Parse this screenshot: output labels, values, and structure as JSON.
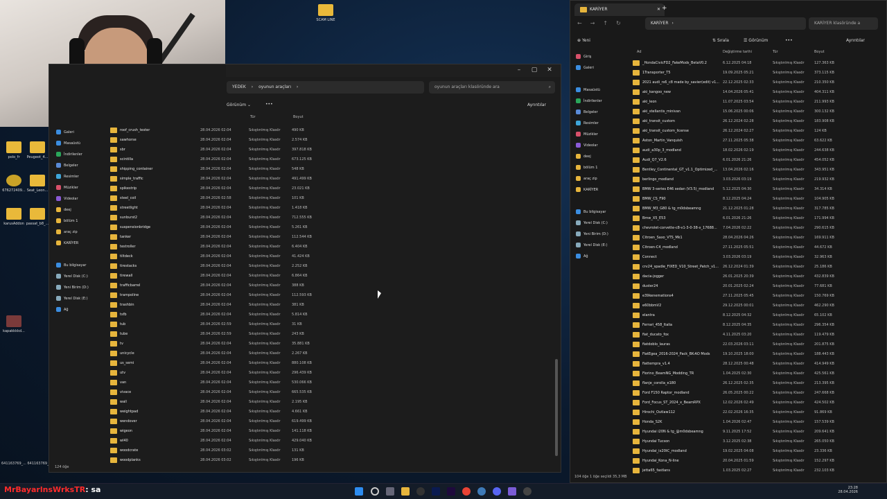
{
  "desktop": {
    "top_icon_label": "SCAM LINE",
    "icons": [
      {
        "label": "polo_fr"
      },
      {
        "label": "Peugeot_4..."
      },
      {
        "label": "676272409..."
      },
      {
        "label": "Seat_Leon..."
      },
      {
        "label": "karusAddon"
      },
      {
        "label": "passat_b8_..."
      },
      {
        "label": "kapakkkkd..."
      }
    ],
    "corner_text": "641163769_...  641163769_..."
  },
  "left_window": {
    "breadcrumb": [
      "YEDEK",
      "oyunun araçları"
    ],
    "search_placeholder": "oyunun araçları klasöründe ara",
    "view_label": "Görünüm",
    "more_label": "•••",
    "details_label": "Ayrıntılar",
    "columns": {
      "name": "Ad",
      "modified": "Değiştirme tarihi",
      "type": "Tür",
      "size": "Boyut"
    },
    "nav": [
      {
        "label": "Galeri",
        "color": "#3b8de0"
      },
      {
        "label": "Masaüstü",
        "color": "#3b8de0"
      },
      {
        "label": "İndirilenler",
        "color": "#2aa65a"
      },
      {
        "label": "Belgeler",
        "color": "#5a8ad6"
      },
      {
        "label": "Resimler",
        "color": "#3ea5d8"
      },
      {
        "label": "Müzikler",
        "color": "#d8506a"
      },
      {
        "label": "Videolar",
        "color": "#8a5ad6"
      },
      {
        "label": "deej",
        "color": "#e7b53c"
      },
      {
        "label": "bölüm 1",
        "color": "#e7b53c"
      },
      {
        "label": "araç zip",
        "color": "#e7b53c"
      },
      {
        "label": "KARİYER",
        "color": "#e7b53c"
      },
      {
        "label": "",
        "color": ""
      },
      {
        "label": "Bu bilgisayar",
        "color": "#3b8de0"
      },
      {
        "label": "Yerel Disk (C:)",
        "color": "#8ab"
      },
      {
        "label": "Yeni Birim (D:)",
        "color": "#8ab"
      },
      {
        "label": "Yerel Disk (E:)",
        "color": "#8ab"
      },
      {
        "label": "Ağ",
        "color": "#3b8de0"
      }
    ],
    "files": [
      [
        "roof_crush_tester",
        "28.04.2026 02:04",
        "Sıkıştırılmış Klasör",
        "490 KB"
      ],
      [
        "sawhorse",
        "28.04.2026 02:04",
        "Sıkıştırılmış Klasör",
        "2.574 KB"
      ],
      [
        "sbr",
        "28.04.2026 02:04",
        "Sıkıştırılmış Klasör",
        "397.818 KB"
      ],
      [
        "scintilla",
        "28.04.2026 02:04",
        "Sıkıştırılmış Klasör",
        "673.125 KB"
      ],
      [
        "shipping_container",
        "28.04.2026 02:04",
        "Sıkıştırılmış Klasör",
        "548 KB"
      ],
      [
        "simple_traffic",
        "28.04.2026 02:04",
        "Sıkıştırılmış Klasör",
        "491.499 KB"
      ],
      [
        "spikestrip",
        "28.04.2026 02:04",
        "Sıkıştırılmış Klasör",
        "23.021 KB"
      ],
      [
        "steel_coil",
        "28.04.2026 02:58",
        "Sıkıştırılmış Klasör",
        "101 KB"
      ],
      [
        "streetlight",
        "28.04.2026 02:04",
        "Sıkıştırılmış Klasör",
        "1.418 KB"
      ],
      [
        "sunburst2",
        "28.04.2026 02:04",
        "Sıkıştırılmış Klasör",
        "712.555 KB"
      ],
      [
        "suspensionbridge",
        "28.04.2026 02:04",
        "Sıkıştırılmış Klasör",
        "5.261 KB"
      ],
      [
        "tanker",
        "28.04.2026 02:04",
        "Sıkıştırılmış Klasör",
        "112.544 KB"
      ],
      [
        "testroller",
        "28.04.2026 02:04",
        "Sıkıştırılmış Klasör",
        "6.404 KB"
      ],
      [
        "tiltdeck",
        "28.04.2026 02:04",
        "Sıkıştırılmış Klasör",
        "41.424 KB"
      ],
      [
        "tirestacks",
        "28.04.2026 02:04",
        "Sıkıştırılmış Klasör",
        "2.252 KB"
      ],
      [
        "tirewall",
        "28.04.2026 02:04",
        "Sıkıştırılmış Klasör",
        "6.864 KB"
      ],
      [
        "trafficbarrel",
        "28.04.2026 02:04",
        "Sıkıştırılmış Klasör",
        "388 KB"
      ],
      [
        "trampoline",
        "28.04.2026 02:04",
        "Sıkıştırılmış Klasör",
        "112.593 KB"
      ],
      [
        "trashbin",
        "28.04.2026 02:04",
        "Sıkıştırılmış Klasör",
        "381 KB"
      ],
      [
        "tsfb",
        "28.04.2026 02:04",
        "Sıkıştırılmış Klasör",
        "5.814 KB"
      ],
      [
        "tub",
        "28.04.2026 02:59",
        "Sıkıştırılmış Klasör",
        "31 KB"
      ],
      [
        "tube",
        "28.04.2026 02:59",
        "Sıkıştırılmış Klasör",
        "243 KB"
      ],
      [
        "tv",
        "28.04.2026 02:04",
        "Sıkıştırılmış Klasör",
        "35.881 KB"
      ],
      [
        "unicycle",
        "28.04.2026 02:04",
        "Sıkıştırılmış Klasör",
        "2.267 KB"
      ],
      [
        "us_semi",
        "28.04.2026 02:04",
        "Sıkıştırılmış Klasör",
        "880.108 KB"
      ],
      [
        "utv",
        "28.04.2026 02:04",
        "Sıkıştırılmış Klasör",
        "296.439 KB"
      ],
      [
        "van",
        "28.04.2026 02:04",
        "Sıkıştırılmış Klasör",
        "530.066 KB"
      ],
      [
        "vivace",
        "28.04.2026 02:04",
        "Sıkıştırılmış Klasör",
        "665.535 KB"
      ],
      [
        "wall",
        "28.04.2026 02:04",
        "Sıkıştırılmış Klasör",
        "2.195 KB"
      ],
      [
        "weightpad",
        "28.04.2026 02:04",
        "Sıkıştırılmış Klasör",
        "4.661 KB"
      ],
      [
        "wendover",
        "28.04.2026 02:04",
        "Sıkıştırılmış Klasör",
        "619.499 KB"
      ],
      [
        "wigeon",
        "28.04.2026 02:04",
        "Sıkıştırılmış Klasör",
        "141.118 KB"
      ],
      [
        "wl40",
        "28.04.2026 02:04",
        "Sıkıştırılmış Klasör",
        "429.040 KB"
      ],
      [
        "woodcrate",
        "28.04.2026 03:02",
        "Sıkıştırılmış Klasör",
        "131 KB"
      ],
      [
        "woodplanks",
        "28.04.2026 03:02",
        "Sıkıştırılmış Klasör",
        "196 KB"
      ]
    ],
    "status": "124 öğe"
  },
  "right_window": {
    "tab_title": "KARİYER",
    "new_tab": "+",
    "breadcrumb": "KARİYER",
    "search_placeholder": "KARİYER klasöründe a",
    "toolbar": {
      "new": "Yeni",
      "sort": "Sırala",
      "view": "Görünüm",
      "more": "•••",
      "details": "Ayrıntılar"
    },
    "columns": {
      "name": "Ad",
      "modified": "Değiştirme tarihi",
      "type": "Tür",
      "size": "Boyut"
    },
    "nav": [
      {
        "label": "Giriş",
        "color": "#d8506a"
      },
      {
        "label": "Galeri",
        "color": "#3b8de0"
      },
      {
        "label": "",
        "color": ""
      },
      {
        "label": "Masaüstü",
        "color": "#3b8de0"
      },
      {
        "label": "İndirilenler",
        "color": "#2aa65a"
      },
      {
        "label": "Belgeler",
        "color": "#5a8ad6"
      },
      {
        "label": "Resimler",
        "color": "#3ea5d8"
      },
      {
        "label": "Müzikler",
        "color": "#d8506a"
      },
      {
        "label": "Videolar",
        "color": "#8a5ad6"
      },
      {
        "label": "deej",
        "color": "#e7b53c"
      },
      {
        "label": "bölüm 1",
        "color": "#e7b53c"
      },
      {
        "label": "araç zip",
        "color": "#e7b53c"
      },
      {
        "label": "KARİYER",
        "color": "#e7b53c"
      },
      {
        "label": "",
        "color": ""
      },
      {
        "label": "Bu bilgisayar",
        "color": "#3b8de0"
      },
      {
        "label": "Yerel Disk (C:)",
        "color": "#8ab"
      },
      {
        "label": "Yeni Birim (D:)",
        "color": "#8ab"
      },
      {
        "label": "Yerel Disk (E:)",
        "color": "#8ab"
      },
      {
        "label": "Ağ",
        "color": "#3b8de0"
      }
    ],
    "files": [
      [
        "_HondaCivicFD2_FakeMods_BetaV0.2",
        "6.12.2025 04:18",
        "Sıkıştırılmış Klasör",
        "127.363 KB"
      ],
      [
        "1Transporter_T5",
        "19.09.2025 05:21",
        "Sıkıştırılmış Klasör",
        "373.115 KB"
      ],
      [
        "2021 audi_rs6_c8 made by_savier(edit) v1...",
        "22.12.2025 02:33",
        "Sıkıştırılmış Klasör",
        "210.350 KB"
      ],
      [
        "aki_kangoo_new",
        "14.04.2026 05:41",
        "Sıkıştırılmış Klasör",
        "404.311 KB"
      ],
      [
        "aki_leon",
        "11.07.2025 03:54",
        "Sıkıştırılmış Klasör",
        "211.993 KB"
      ],
      [
        "aki_stellantis_minivan",
        "15.06.2025 00:06",
        "Sıkıştırılmış Klasör",
        "300.132 KB"
      ],
      [
        "aki_transit_custom",
        "26.12.2024 02:28",
        "Sıkıştırılmış Klasör",
        "183.908 KB"
      ],
      [
        "aki_transit_custom_license",
        "26.12.2024 02:27",
        "Sıkıştırılmış Klasör",
        "124 KB"
      ],
      [
        "Aston_Martin_Vanquish",
        "27.11.2025 05:38",
        "Sıkıştırılmış Klasör",
        "63.622 KB"
      ],
      [
        "audi_a30p_3_modland",
        "18.02.2026 02:19",
        "Sıkıştırılmış Klasör",
        "244.638 KB"
      ],
      [
        "Audi_Q7_V2.6",
        "6.01.2026 21:26",
        "Sıkıştırılmış Klasör",
        "454.052 KB"
      ],
      [
        "Bentley_Continental_GT_v1.1_Optimized_...",
        "13.04.2026 02:16",
        "Sıkıştırılmış Klasör",
        "343.951 KB"
      ],
      [
        "berlingo_modland",
        "3.03.2026 03:19",
        "Sıkıştırılmış Klasör",
        "219.932 KB"
      ],
      [
        "BMW 3-series E46 sedan (V3.5)_modland",
        "5.12.2025 04:30",
        "Sıkıştırılmış Klasör",
        "34.314 KB"
      ],
      [
        "BMW_CS_F90",
        "8.12.2025 04:24",
        "Sıkıştırılmış Klasör",
        "104.905 KB"
      ],
      [
        "BMW_M3_G80 & tg_m0dsbeamng",
        "21.12.2025 01:28",
        "Sıkıştırılmış Klasör",
        "317.785 KB"
      ],
      [
        "Bmw_X5_E53",
        "6.01.2026 21:26",
        "Sıkıştırılmış Klasör",
        "171.994 KB"
      ],
      [
        "chevrolet-corvette-c8-v1-3-0-38-x_17688...",
        "7.04.2026 02:22",
        "Sıkıştırılmış Klasör",
        "290.615 KB"
      ],
      [
        "Citroen_Saxo_VTS_Mk1",
        "28.04.2026 04:26",
        "Sıkıştırılmış Klasör",
        "169.911 KB"
      ],
      [
        "Citroen-C4_modland",
        "27.11.2025 05:51",
        "Sıkıştırılmış Klasör",
        "44.672 KB"
      ],
      [
        "Connect",
        "3.03.2026 03:19",
        "Sıkıştırılmış Klasör",
        "32.963 KB"
      ],
      [
        "crv24_spadie_FIXED_V10_Street_Patch_v1...",
        "26.12.2024 01:39",
        "Sıkıştırılmış Klasör",
        "25.186 KB"
      ],
      [
        "dacia-jogger",
        "26.01.2025 20:39",
        "Sıkıştırılmış Klasör",
        "432.839 KB"
      ],
      [
        "duster24",
        "20.01.2025 02:24",
        "Sıkıştırılmış Klasör",
        "77.681 KB"
      ],
      [
        "e39kenemations4",
        "27.11.2025 05:45",
        "Sıkıştırılmış Klasör",
        "150.769 KB"
      ],
      [
        "e60bbmV2",
        "29.12.2025 00:01",
        "Sıkıştırılmış Klasör",
        "462.290 KB"
      ],
      [
        "elantra",
        "8.12.2025 04:32",
        "Sıkıştırılmış Klasör",
        "65.102 KB"
      ],
      [
        "Ferrari_458_Italia",
        "8.12.2025 04:35",
        "Sıkıştırılmış Klasör",
        "296.354 KB"
      ],
      [
        "fiat_ducato_fox",
        "4.11.2025 03:20",
        "Sıkıştırılmış Klasör",
        "119.479 KB"
      ],
      [
        "fiatdoblo_lauras",
        "22.03.2026 03:11",
        "Sıkıştırılmış Klasör",
        "201.875 KB"
      ],
      [
        "FiatEgea_2016-2024_Pack_BK-AO Mods",
        "19.10.2025 18:00",
        "Sıkıştırılmış Klasör",
        "188.443 KB"
      ],
      [
        "fiattempra_v1.4",
        "28.12.2025 00:48",
        "Sıkıştırılmış Klasör",
        "414.949 KB"
      ],
      [
        "Fiorino_BeamNG_Modding_TR",
        "1.04.2025 02:30",
        "Sıkıştırılmış Klasör",
        "425.561 KB"
      ],
      [
        "flanje_corolla_e180",
        "26.12.2025 02:35",
        "Sıkıştırılmış Klasör",
        "213.395 KB"
      ],
      [
        "Ford F150 Raptor_modland",
        "26.05.2025 00:22",
        "Sıkıştırılmış Klasör",
        "247.668 KB"
      ],
      [
        "Ford_Focus_ST_2024_x_BeamRPX",
        "12.02.2026 02:49",
        "Sıkıştırılmış Klasör",
        "424.502 KB"
      ],
      [
        "Hirochi_Outlaw112",
        "22.02.2026 16:35",
        "Sıkıştırılmış Klasör",
        "91.869 KB"
      ],
      [
        "Honda_S2K",
        "1.04.2026 02:47",
        "Sıkıştırılmış Klasör",
        "157.539 KB"
      ],
      [
        "Hyundai i20N & tg_@m0dsbeamng",
        "9.11.2025 17:52",
        "Sıkıştırılmış Klasör",
        "209.641 KB"
      ],
      [
        "Hyundai Tucson",
        "3.12.2025 02:38",
        "Sıkıştırılmış Klasör",
        "265.050 KB"
      ],
      [
        "Hyundai_ix20tC_modland",
        "19.02.2025 04:08",
        "Sıkıştırılmış Klasör",
        "23.336 KB"
      ],
      [
        "Hyundai_Kona_N-line",
        "20.04.2025 01:59",
        "Sıkıştırılmış Klasör",
        "152.297 KB"
      ],
      [
        "jetta65_fastlans",
        "1.03.2025 02:27",
        "Sıkıştırılmış Klasör",
        "232.103 KB"
      ]
    ],
    "status": "104 öğe   1 öğe seçildi 35,3 MB"
  },
  "chat": {
    "user": "MrBayarlnsWrksTR",
    "message": ": sa"
  },
  "clock": {
    "time": "23:28",
    "date": "28.04.2026"
  }
}
